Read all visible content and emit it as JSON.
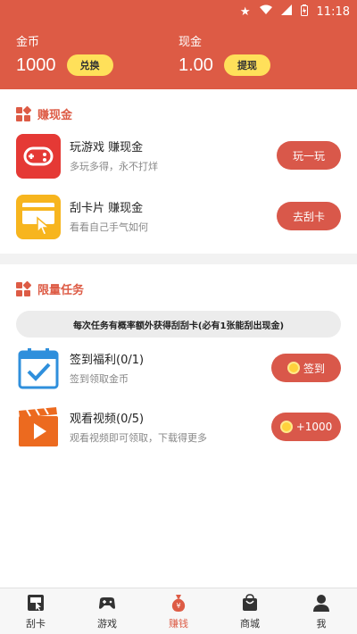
{
  "status_bar": {
    "time": "11:18"
  },
  "header": {
    "coins": {
      "label": "金币",
      "value": "1000",
      "button": "兑换"
    },
    "cash": {
      "label": "现金",
      "value": "1.00",
      "button": "提现"
    }
  },
  "earn_section": {
    "title": "赚现金",
    "items": [
      {
        "title": "玩游戏 赚现金",
        "subtitle": "多玩多得，永不打烊",
        "button": "玩一玩"
      },
      {
        "title": "刮卡片 赚现金",
        "subtitle": "看看自己手气如何",
        "button": "去刮卡"
      }
    ]
  },
  "tasks_section": {
    "title": "限量任务",
    "notice": "每次任务有概率额外获得刮刮卡(必有1张能刮出现金)",
    "items": [
      {
        "title": "签到福利(0/1)",
        "subtitle": "签到领取金币",
        "button": "签到"
      },
      {
        "title": "观看视频(0/5)",
        "subtitle": "观看视频即可领取，下载得更多",
        "button": "+1000"
      }
    ]
  },
  "tabbar": {
    "tabs": [
      {
        "label": "刮卡"
      },
      {
        "label": "游戏"
      },
      {
        "label": "赚钱"
      },
      {
        "label": "商城"
      },
      {
        "label": "我"
      }
    ]
  },
  "colors": {
    "accent": "#dd5b45",
    "button_yellow": "#ffe05a",
    "card": "#ffffff",
    "background": "#f2f2f2"
  }
}
